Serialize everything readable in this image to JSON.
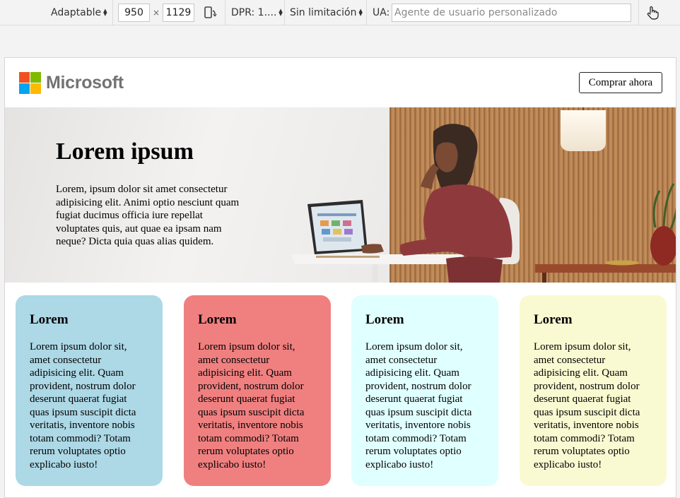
{
  "toolbar": {
    "device_label": "Adaptable",
    "width_value": "950",
    "times_sign": "×",
    "height_value": "1129",
    "dpr_label": "DPR: 1....",
    "throttle_label": "Sin limitación",
    "ua_label": "UA:",
    "ua_placeholder": "Agente de usuario personalizado"
  },
  "page": {
    "brand": "Microsoft",
    "brand_colors": [
      "#f25022",
      "#7fba00",
      "#00a4ef",
      "#ffb900"
    ],
    "buy_button": "Comprar ahora",
    "hero": {
      "title": "Lorem ipsum",
      "text": "Lorem, ipsum dolor sit amet consectetur adipisicing elit. Animi optio nesciunt quam fugiat ducimus officia iure repellat voluptates quis, aut quae ea ipsam nam neque? Dicta quia quas alias quidem."
    },
    "cards": [
      {
        "title": "Lorem",
        "text": "Lorem ipsum dolor sit, amet consectetur adipisicing elit. Quam provident, nostrum dolor deserunt quaerat fugiat quas ipsum suscipit dicta veritatis, inventore nobis totam commodi? Totam rerum voluptates optio explicabo iusto!",
        "color": "#add8e6"
      },
      {
        "title": "Lorem",
        "text": "Lorem ipsum dolor sit, amet consectetur adipisicing elit. Quam provident, nostrum dolor deserunt quaerat fugiat quas ipsum suscipit dicta veritatis, inventore nobis totam commodi? Totam rerum voluptates optio explicabo iusto!",
        "color": "#f08080"
      },
      {
        "title": "Lorem",
        "text": "Lorem ipsum dolor sit, amet consectetur adipisicing elit. Quam provident, nostrum dolor deserunt quaerat fugiat quas ipsum suscipit dicta veritatis, inventore nobis totam commodi? Totam rerum voluptates optio explicabo iusto!",
        "color": "#e0ffff"
      },
      {
        "title": "Lorem",
        "text": "Lorem ipsum dolor sit, amet consectetur adipisicing elit. Quam provident, nostrum dolor deserunt quaerat fugiat quas ipsum suscipit dicta veritatis, inventore nobis totam commodi? Totam rerum voluptates optio explicabo iusto!",
        "color": "#fafad2"
      }
    ]
  }
}
